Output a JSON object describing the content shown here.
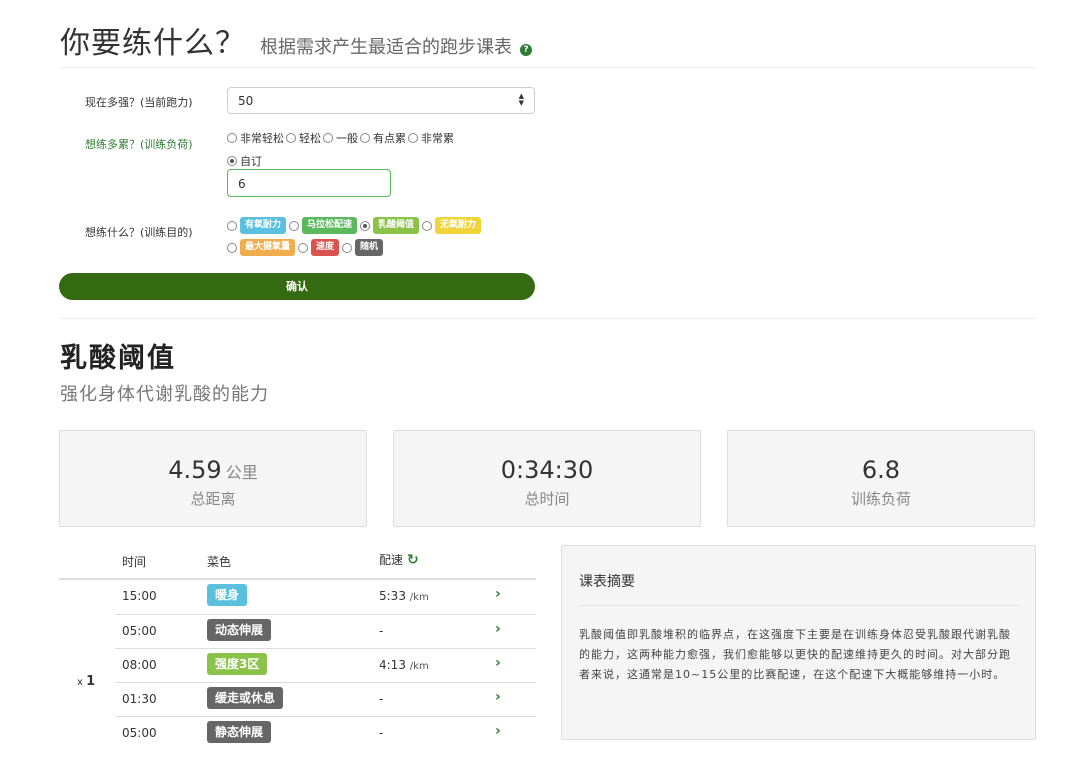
{
  "header": {
    "title": "你要练什么？",
    "subtitle": "根据需求产生最适合的跑步课表",
    "help_glyph": "?"
  },
  "form": {
    "current_label": "现在多强？(当前跑力)",
    "current_value": "50",
    "load_label": "想练多累？(训练负荷)",
    "load_options": [
      "非常轻松",
      "轻松",
      "一般",
      "有点累",
      "非常累"
    ],
    "custom_label": "自订",
    "custom_value": "6",
    "purpose_label": "想练什么？(训练目的)",
    "purposes": [
      {
        "label": "有氧耐力",
        "color": "#5bc0de",
        "checked": false
      },
      {
        "label": "马拉松配速",
        "color": "#5cb85c",
        "checked": false
      },
      {
        "label": "乳酸阈值",
        "color": "#8bc34a",
        "checked": true
      },
      {
        "label": "无氧耐力",
        "color": "#f0d43a",
        "checked": false
      },
      {
        "label": "最大摄氧量",
        "color": "#f0ad4e",
        "checked": false
      },
      {
        "label": "速度",
        "color": "#d9534f",
        "checked": false
      },
      {
        "label": "随机",
        "color": "#666666",
        "checked": false
      }
    ],
    "confirm_label": "确认"
  },
  "workout": {
    "title": "乳酸阈值",
    "subtitle": "强化身体代谢乳酸的能力"
  },
  "stats": [
    {
      "value": "4.59",
      "unit": "公里",
      "label": "总距离"
    },
    {
      "value": "0:34:30",
      "unit": "",
      "label": "总时间"
    },
    {
      "value": "6.8",
      "unit": "",
      "label": "训练负荷"
    }
  ],
  "table": {
    "headers": {
      "time": "时间",
      "menu": "菜色",
      "pace": "配速",
      "refresh_icon": "↻"
    },
    "repeat_prefix": "x",
    "repeat_count": "1",
    "chevron": "›",
    "rows": [
      {
        "time": "15:00",
        "menu": "暖身",
        "color": "#5bc0de",
        "pace": "5:33",
        "unit": "/km"
      },
      {
        "time": "05:00",
        "menu": "动态伸展",
        "color": "#666666",
        "pace": "-",
        "unit": ""
      },
      {
        "time": "08:00",
        "menu": "强度3区",
        "color": "#8bc34a",
        "pace": "4:13",
        "unit": "/km"
      },
      {
        "time": "01:30",
        "menu": "缓走或休息",
        "color": "#666666",
        "pace": "-",
        "unit": ""
      },
      {
        "time": "05:00",
        "menu": "静态伸展",
        "color": "#666666",
        "pace": "-",
        "unit": ""
      }
    ]
  },
  "summary": {
    "title": "课表摘要",
    "text": "乳酸阈值即乳酸堆积的临界点，在这强度下主要是在训练身体忍受乳酸跟代谢乳酸的能力，这两种能力愈强，我们愈能够以更快的配速维持更久的时间。对大部分跑者来说，这通常是10~15公里的比赛配速，在这个配速下大概能够维持一小时。"
  }
}
